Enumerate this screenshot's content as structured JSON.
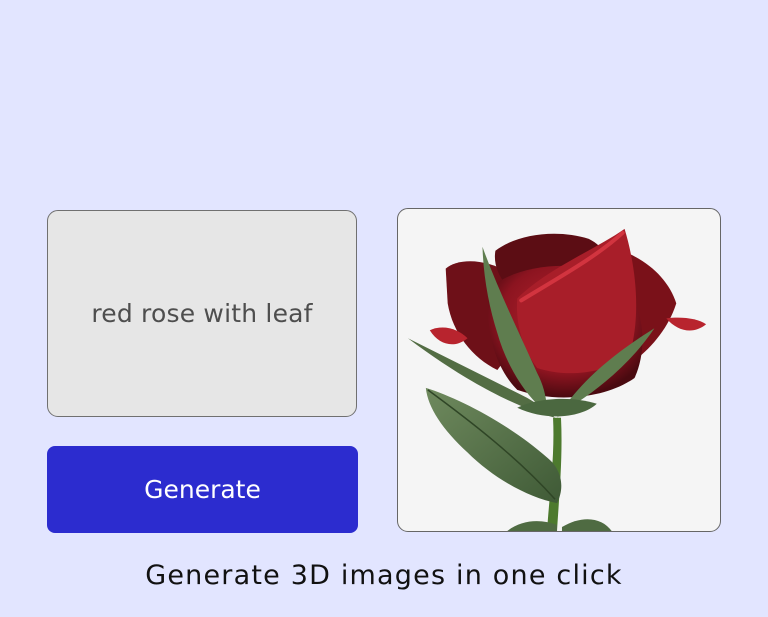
{
  "prompt": {
    "text": "red rose with leaf"
  },
  "actions": {
    "generate_label": "Generate"
  },
  "result": {
    "image_alt": "red rose with leaf"
  },
  "tagline": "Generate 3D images in one click",
  "colors": {
    "page_background": "#e2e5ff",
    "prompt_background": "#e6e6e6",
    "button_background": "#2c2ccf",
    "button_text": "#ffffff",
    "rose_red": "#9b1b24",
    "leaf_green": "#56704a"
  }
}
